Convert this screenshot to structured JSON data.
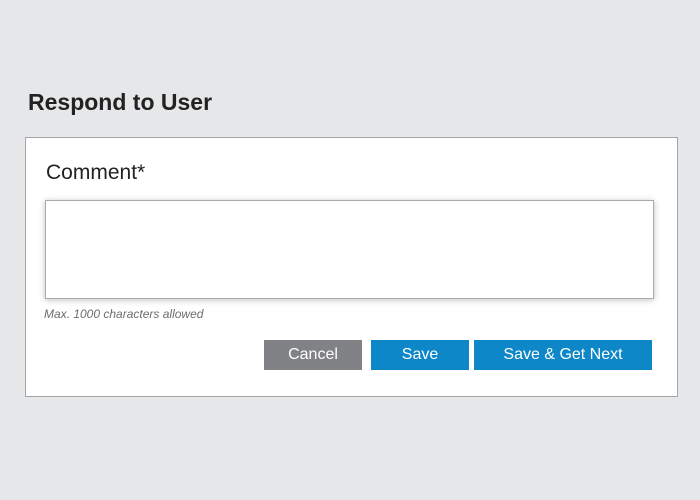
{
  "page": {
    "title": "Respond to User"
  },
  "form": {
    "comment_label": "Comment*",
    "comment_value": "",
    "comment_placeholder": "",
    "hint": "Max. 1000 characters allowed"
  },
  "actions": {
    "cancel_label": "Cancel",
    "save_label": "Save",
    "save_next_label": "Save & Get Next"
  },
  "colors": {
    "background": "#e6e7e9",
    "primary_button": "#0d87c7",
    "secondary_button": "#808285"
  }
}
